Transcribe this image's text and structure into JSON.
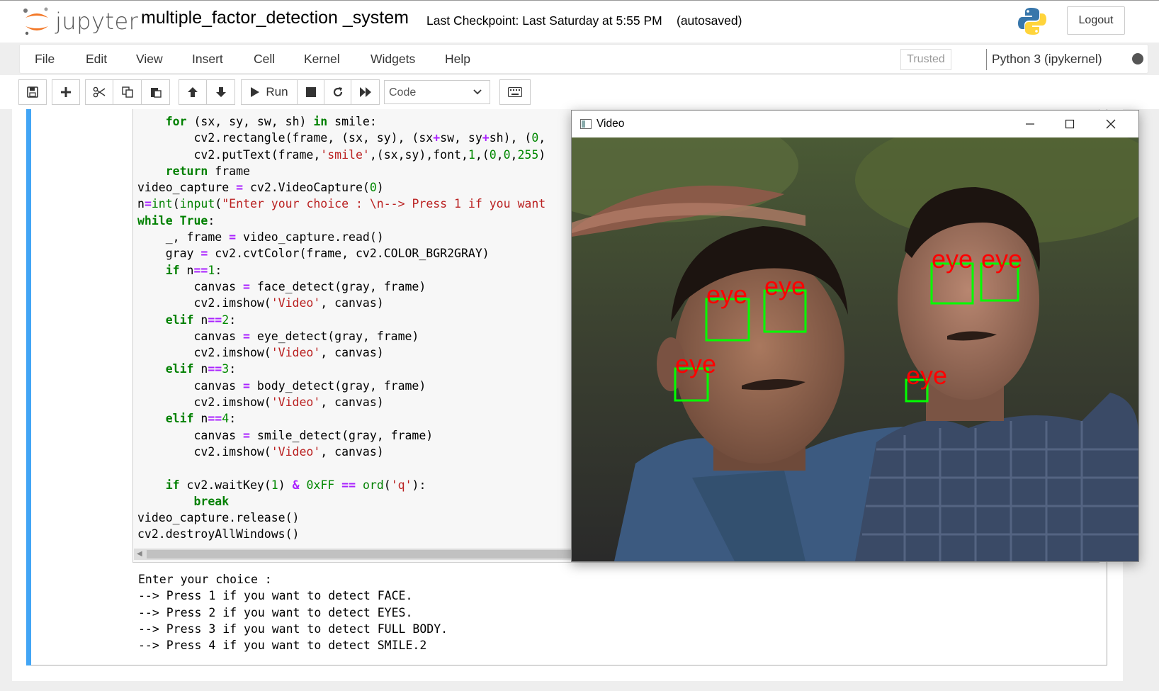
{
  "header": {
    "logo_text": "jupyter",
    "notebook_name": "multiple_factor_detection _system",
    "checkpoint": "Last Checkpoint: Last Saturday at 5:55 PM",
    "autosave": "(autosaved)",
    "logout_label": "Logout"
  },
  "menu": {
    "items": [
      "File",
      "Edit",
      "View",
      "Insert",
      "Cell",
      "Kernel",
      "Widgets",
      "Help"
    ],
    "trusted_label": "Trusted",
    "kernel_name": "Python 3 (ipykernel)"
  },
  "toolbar": {
    "run_label": "Run",
    "cell_type": "Code",
    "icons": [
      "save-icon",
      "plus-icon",
      "cut-icon",
      "copy-icon",
      "paste-icon",
      "arrow-up-icon",
      "arrow-down-icon",
      "play-icon",
      "stop-icon",
      "restart-icon",
      "fast-forward-icon",
      "keyboard-icon"
    ]
  },
  "cell": {
    "code_lines": [
      "    for (sx, sy, sw, sh) in smile:",
      "        cv2.rectangle(frame, (sx, sy), (sx+sw, sy+sh), (0,",
      "        cv2.putText(frame,'smile',(sx,sy),font,1,(0,0,255)",
      "    return frame",
      "video_capture = cv2.VideoCapture(0)",
      "n=int(input(\"Enter your choice : \\n--> Press 1 if you want",
      "while True:",
      "    _, frame = video_capture.read()",
      "    gray = cv2.cvtColor(frame, cv2.COLOR_BGR2GRAY)",
      "    if n==1:",
      "        canvas = face_detect(gray, frame)",
      "        cv2.imshow('Video', canvas)",
      "    elif n==2:",
      "        canvas = eye_detect(gray, frame)",
      "        cv2.imshow('Video', canvas)",
      "    elif n==3:",
      "        canvas = body_detect(gray, frame)",
      "        cv2.imshow('Video', canvas)",
      "    elif n==4:",
      "        canvas = smile_detect(gray, frame)",
      "        cv2.imshow('Video', canvas)",
      "",
      "    if cv2.waitKey(1) & 0xFF == ord('q'):",
      "        break",
      "video_capture.release()",
      "cv2.destroyAllWindows()"
    ],
    "output_lines": [
      "Enter your choice :",
      "--> Press 1 if you want to detect FACE.",
      "--> Press 2 if you want to detect EYES.",
      "--> Press 3 if you want to detect FULL BODY.",
      "--> Press 4 if you want to detect SMILE.2"
    ]
  },
  "video_window": {
    "title": "Video",
    "detection_label": "eye",
    "detection_count": 6,
    "box_color": "#00ff00",
    "label_color": "#ff0000"
  }
}
